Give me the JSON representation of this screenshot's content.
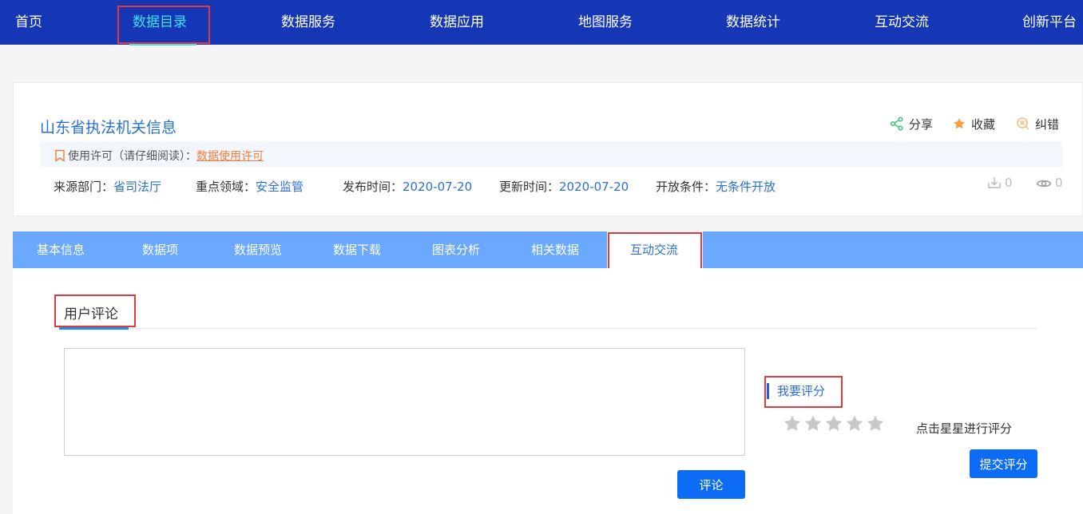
{
  "nav": {
    "items": [
      "首页",
      "数据目录",
      "数据服务",
      "数据应用",
      "地图服务",
      "数据统计",
      "互动交流",
      "创新平台"
    ],
    "active_index": 1
  },
  "dataset": {
    "title": "山东省执法机关信息",
    "actions": {
      "share": "分享",
      "favorite": "收藏",
      "report": "纠错"
    },
    "license_label": "使用许可（请仔细阅读）：",
    "license_link": "数据使用许可",
    "meta": {
      "source_label": "来源部门：",
      "source_value": "省司法厅",
      "domain_label": "重点领域：",
      "domain_value": "安全监管",
      "published_label": "发布时间：",
      "published_value": "2020-07-20",
      "updated_label": "更新时间：",
      "updated_value": "2020-07-20",
      "open_label": "开放条件：",
      "open_value": "无条件开放"
    },
    "downloads": "0",
    "views": "0"
  },
  "tabs": {
    "items": [
      "基本信息",
      "数据项",
      "数据预览",
      "数据下载",
      "图表分析",
      "相关数据",
      "互动交流"
    ],
    "active_index": 6
  },
  "comments": {
    "section_title": "用户评论",
    "placeholder": "",
    "submit_label": "评论"
  },
  "rating": {
    "title": "我要评分",
    "hint": "点击星星进行评分",
    "submit_label": "提交评分",
    "value": 0,
    "max": 5
  },
  "colors": {
    "nav_bg": "#1537b5",
    "nav_active": "#3fe0f5",
    "tab_bg": "#6aa9fd",
    "link_blue": "#2a6fd4",
    "primary_button": "#0c6cf5",
    "highlight_box": "#e0393e",
    "license_link": "#f07d3a"
  }
}
